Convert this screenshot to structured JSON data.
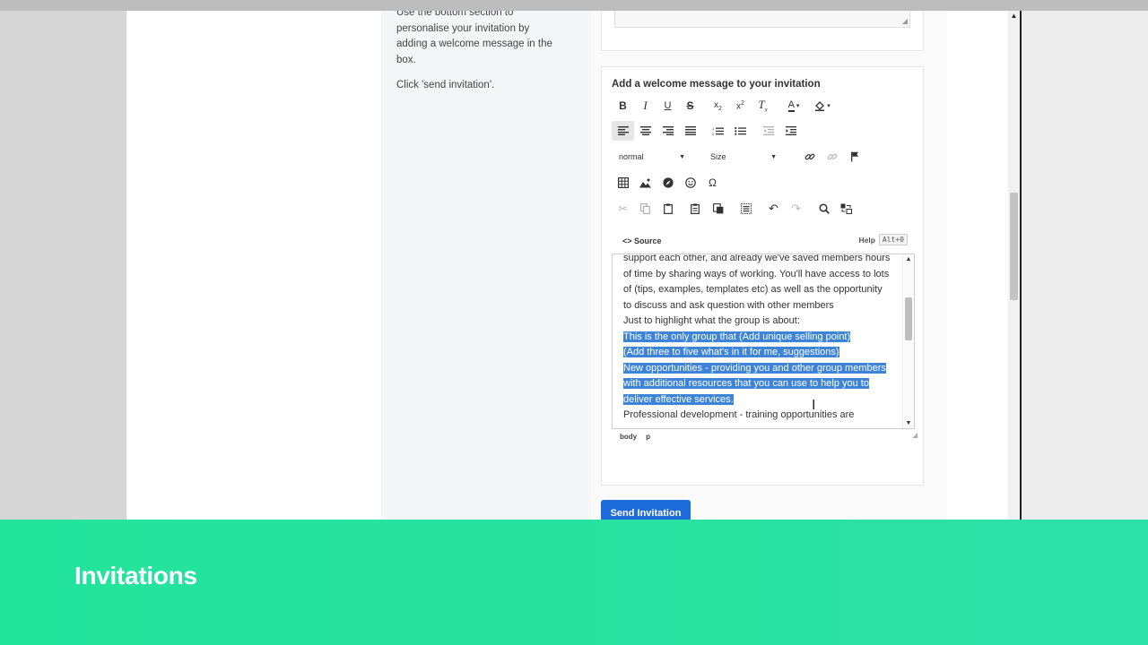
{
  "instructions": {
    "para1": "Use the bottom section to personalise your invitation by adding a welcome message in the box.",
    "para2": "Click 'send invitation'."
  },
  "editor": {
    "label": "Add a welcome message to your invitation",
    "format_select": "normal",
    "size_select": "Size",
    "source_label": "Source",
    "help_label": "Help",
    "help_shortcut": "Alt+0",
    "content": {
      "line1": "support each other, and already we've saved members hours of time by sharing ways of working. You'll have access to lots of (tips, examples, templates etc) as well as the opportunity to discuss and ask question with other members",
      "line2": "Just to highlight what the group is about:",
      "selected1": "This is the only group that (Add unique selling point)",
      "selected2": "(Add three to five what's in it for me, suggestions)",
      "selected3": "New opportunities - providing you and other group members with additional resources that you can use to help you to deliver effective services.",
      "line3": "Professional development - training opportunities are"
    },
    "path": [
      "body",
      "p"
    ]
  },
  "send_button": "Send Invitation",
  "banner_title": "Invitations",
  "colors": {
    "banner": "#22e39c",
    "button": "#1e6bdc",
    "selection": "#3d83d8"
  }
}
